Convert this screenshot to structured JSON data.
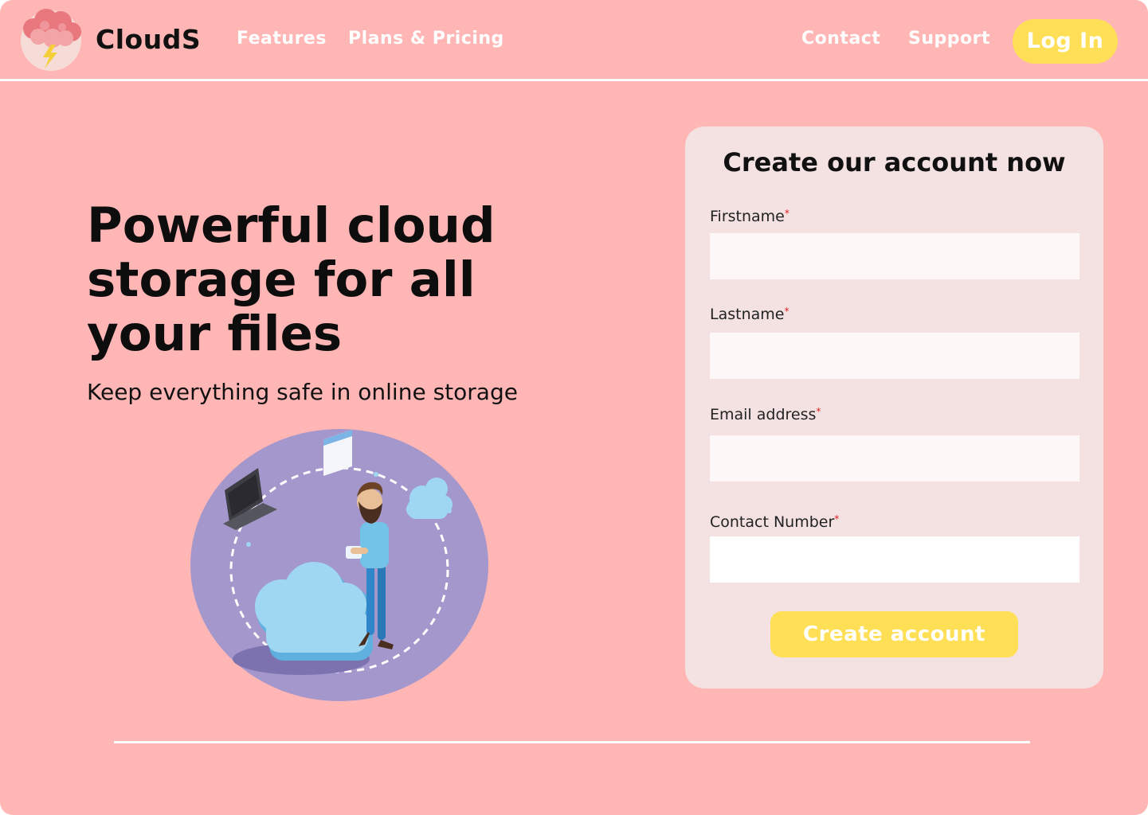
{
  "brand": {
    "name": "CloudS"
  },
  "nav": {
    "features": "Features",
    "plans": "Plans & Pricing",
    "contact": "Contact",
    "support": "Support",
    "login": "Log In"
  },
  "hero": {
    "title_line1": "Powerful cloud",
    "title_line2": "storage for all",
    "title_line3": "your files",
    "subtitle": "Keep everything safe in online storage"
  },
  "form": {
    "title": "Create our account now",
    "required_mark": "*",
    "fields": {
      "firstname": {
        "label": "Firstname",
        "value": ""
      },
      "lastname": {
        "label": "Lastname",
        "value": ""
      },
      "email": {
        "label": "Email address",
        "value": ""
      },
      "contact": {
        "label": "Contact Number",
        "value": ""
      }
    },
    "submit": "Create account"
  },
  "colors": {
    "background": "#ffb6b5",
    "accent": "#ffdf55",
    "card": "#f4e2e2",
    "illustration_circle": "#a497cc",
    "cloud": "#9fd6f2"
  }
}
